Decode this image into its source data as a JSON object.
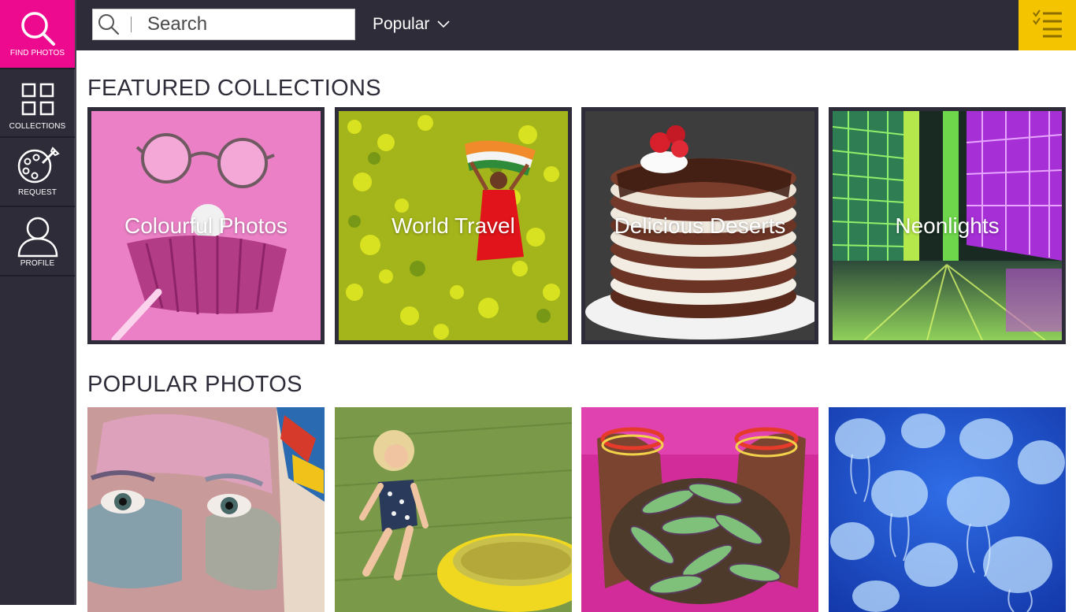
{
  "sidebar": {
    "items": [
      {
        "label": "FIND PHOTOS",
        "icon": "search-icon",
        "active": true
      },
      {
        "label": "COLLECTIONS",
        "icon": "grid-icon",
        "active": false
      },
      {
        "label": "REQUEST",
        "icon": "palette-icon",
        "active": false
      },
      {
        "label": "PROFILE",
        "icon": "user-icon",
        "active": false
      }
    ]
  },
  "topbar": {
    "search": {
      "placeholder": "Search",
      "value": ""
    },
    "sort": {
      "selected": "Popular"
    },
    "menu_icon": "checklist-icon"
  },
  "featured": {
    "title": "FEATURED COLLECTIONS",
    "collections": [
      {
        "label": "Colourful Photos"
      },
      {
        "label": "World Travel"
      },
      {
        "label": "Delicious Deserts"
      },
      {
        "label": "Neonlights"
      }
    ]
  },
  "popular": {
    "title": "POPULAR PHOTOS"
  },
  "colors": {
    "sidebar_bg": "#2d2c38",
    "active_accent": "#ee0a8f",
    "menu_accent": "#f5c400",
    "text_dark": "#2d2c38"
  }
}
